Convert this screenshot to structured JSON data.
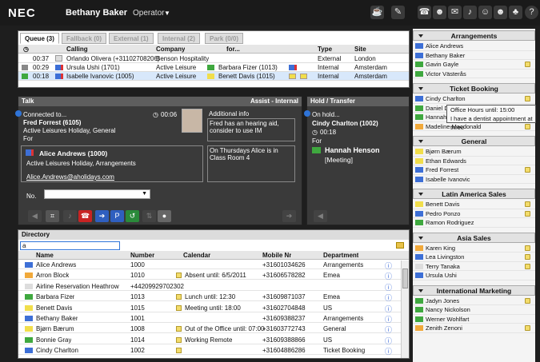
{
  "header": {
    "brand": "NEC",
    "user": "Bethany Baker",
    "role": "Operator"
  },
  "queue": {
    "tabs": [
      {
        "label": "Queue (3)"
      },
      {
        "label": "Fallback (0)"
      },
      {
        "label": "External (1)"
      },
      {
        "label": "Internal (2)"
      },
      {
        "label": "Park (0/0)"
      }
    ],
    "cols": {
      "calling": "Calling",
      "company": "Company",
      "for": "for...",
      "type": "Type",
      "site": "Site"
    },
    "rows": [
      {
        "time": "00:37",
        "calling": "Orlando Olivera (+31102708206)",
        "company": "Benson Hospitality",
        "for": "",
        "type": "External",
        "site": "London"
      },
      {
        "time": "00:29",
        "calling": "Ursula Ushi (1701)",
        "company": "Active Leisure",
        "for": "Barbara Fizer (1013)",
        "type": "Internal",
        "site": "Amsterdam"
      },
      {
        "time": "00:18",
        "calling": "Isabelle Ivanovic (1005)",
        "company": "Active Leisure",
        "for": "Benett Davis (1015)",
        "type": "Internal",
        "site": "Amsterdam"
      }
    ]
  },
  "talk": {
    "title": "Talk",
    "subtitle": "Assist - Internal",
    "connected": "Connected to...",
    "timer": "00:06",
    "caller": "Fred Forrest (6105)",
    "caller_co": "Active Leisures Holiday, General",
    "for_label": "For",
    "target": "Alice Andrews (1000)",
    "target_co": "Active Leisures Holiday, Arrangements",
    "email": "Alice.Andrews@aholidays.com",
    "addinfo_label": "Additional info",
    "addinfo1": "Fred has an hearing aid, consider to use IM",
    "addinfo2": "On Thursdays Alice is in Class Room 4",
    "no_label": "No."
  },
  "hold": {
    "title": "Hold / Transfer",
    "on_hold": "On hold...",
    "name": "Cindy Charlton (1002)",
    "timer": "00:18",
    "for_label": "For",
    "target": "Hannah Henson",
    "status": "[Meeting]"
  },
  "directory": {
    "title": "Directory",
    "search_value": "a",
    "cols": {
      "name": "Name",
      "number": "Number",
      "calendar": "Calendar",
      "mobile": "Mobile Nr",
      "department": "Department"
    },
    "rows": [
      {
        "name": "Alice Andrews",
        "number": "1000",
        "calendar": "",
        "mobile": "+31601034626",
        "department": "Arrangements"
      },
      {
        "name": "Arron Block",
        "number": "1010",
        "calendar": "Absent until: 6/5/2011",
        "mobile": "+31606578282",
        "department": "Emea"
      },
      {
        "name": "Airline Reservation Heathrow",
        "number": "+44209929702302",
        "calendar": "",
        "mobile": "",
        "department": ""
      },
      {
        "name": "Barbara Fizer",
        "number": "1013",
        "calendar": "Lunch until: 12:30",
        "mobile": "+31609871037",
        "department": "Emea"
      },
      {
        "name": "Benett Davis",
        "number": "1015",
        "calendar": "Meeting until: 18:00",
        "mobile": "+31602704848",
        "department": "US"
      },
      {
        "name": "Bethany Baker",
        "number": "1001",
        "calendar": "",
        "mobile": "+31609388237",
        "department": "Arrangements"
      },
      {
        "name": "Bjørn Bærum",
        "number": "1008",
        "calendar": "Out of the Office until: 07:00",
        "mobile": "+31603772743",
        "department": "General"
      },
      {
        "name": "Bonnie Gray",
        "number": "1014",
        "calendar": "Working Remote",
        "mobile": "+31609388866",
        "department": "US"
      },
      {
        "name": "Cindy Charlton",
        "number": "1002",
        "calendar": "",
        "mobile": "+31604886286",
        "department": "Ticket Booking"
      }
    ]
  },
  "sidebar": {
    "groups": [
      {
        "title": "Arrangements",
        "items": [
          "Alice Andrews",
          "Bethany Baker",
          "Gavin Gayle",
          "Victor Västerås"
        ]
      },
      {
        "title": "Ticket Booking",
        "items": [
          "Cindy Charlton",
          "Daniel Dunn",
          "Hannah Henson",
          "Madeline Macdonald"
        ]
      },
      {
        "title": "General",
        "items": [
          "Bjørn Bærum",
          "Ethan Edwards",
          "Fred Forrest",
          "Isabelle Ivanovic"
        ]
      },
      {
        "title": "Latin America Sales",
        "items": [
          "Benett Davis",
          "Pedro Ponzo",
          "Ramon Rodriguez"
        ]
      },
      {
        "title": "Asia Sales",
        "items": [
          "Karen King",
          "Lea Livingston",
          "Terry Tanaka",
          "Ursula Ushi"
        ]
      },
      {
        "title": "International Marketing",
        "items": [
          "Jadyn Jones",
          "Nancy Nickolson",
          "Werner Wohlfart",
          "Zenith Zenoni"
        ]
      }
    ]
  },
  "tooltip": {
    "line1": "Office Hours until: 15:00",
    "line2": "I have a dentist appointment at three"
  }
}
